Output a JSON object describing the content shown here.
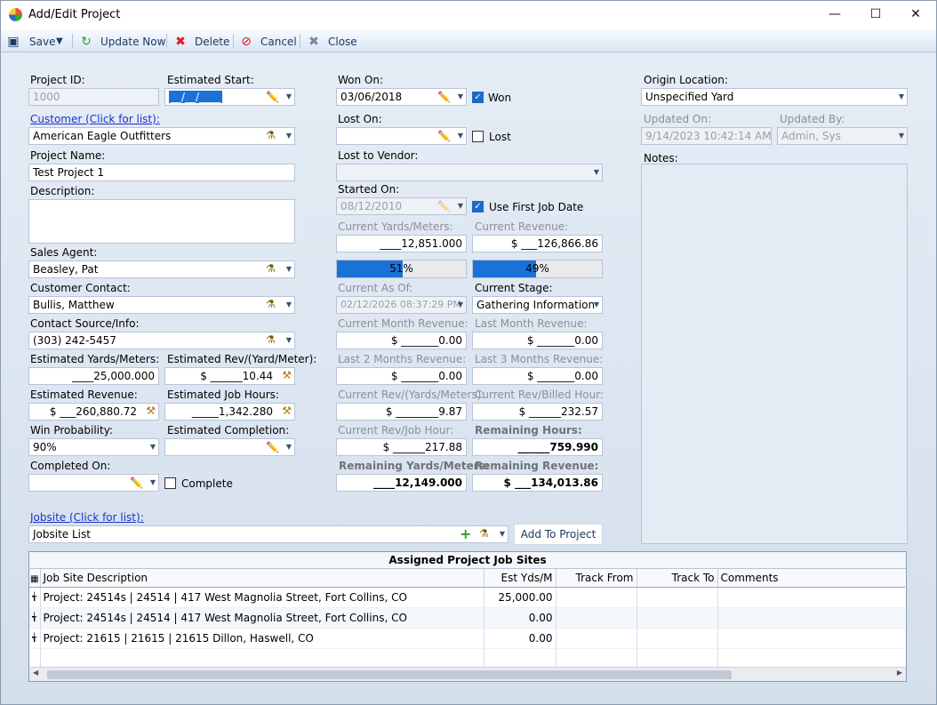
{
  "window": {
    "title": "Add/Edit Project"
  },
  "toolbar": {
    "save": "Save",
    "update_now": "Update Now",
    "delete": "Delete",
    "cancel": "Cancel",
    "close": "Close"
  },
  "left": {
    "project_id_label": "Project ID:",
    "project_id": "1000",
    "est_start_label": "Estimated Start:",
    "est_start": "__/__/____",
    "customer_label": "Customer (Click for list):",
    "customer": "American Eagle Outfitters",
    "project_name_label": "Project Name:",
    "project_name": "Test Project 1",
    "description_label": "Description:",
    "sales_agent_label": "Sales Agent:",
    "sales_agent": "Beasley, Pat",
    "customer_contact_label": "Customer Contact:",
    "customer_contact": "Bullis, Matthew",
    "contact_source_label": "Contact Source/Info:",
    "contact_source": "(303) 242-5457",
    "est_yards_label": "Estimated Yards/Meters:",
    "est_yards": "____25,000.000",
    "est_rev_yard_label": "Estimated Rev/(Yard/Meter):",
    "est_rev_yard": "$ ______10.44",
    "est_revenue_label": "Estimated Revenue:",
    "est_revenue": "$ ___260,880.72",
    "est_job_hours_label": "Estimated Job Hours:",
    "est_job_hours": "_____1,342.280",
    "win_prob_label": "Win Probability:",
    "win_prob": "90%",
    "est_completion_label": "Estimated Completion:",
    "completed_on_label": "Completed On:",
    "complete_label": "Complete",
    "jobsite_label": "Jobsite (Click for list):",
    "jobsite": "Jobsite List",
    "add_to_project": "Add To Project"
  },
  "middle": {
    "won_on_label": "Won On:",
    "won_on": "03/06/2018",
    "won_label": "Won",
    "lost_on_label": "Lost On:",
    "lost_label": "Lost",
    "lost_vendor_label": "Lost to Vendor:",
    "started_on_label": "Started On:",
    "started_on": "08/12/2010",
    "use_first_job_label": "Use First Job Date",
    "cur_yards_label": "Current Yards/Meters:",
    "cur_yards": "____12,851.000",
    "cur_revenue_label": "Current Revenue:",
    "cur_revenue": "$ ___126,866.86",
    "progress1_text": "51%",
    "progress1": 51,
    "progress2_text": "49%",
    "progress2": 49,
    "cur_as_of_label": "Current As Of:",
    "cur_as_of": "02/12/2026 08:37:29 PM",
    "cur_stage_label": "Current Stage:",
    "cur_stage": "Gathering Information",
    "cur_month_rev_label": "Current Month Revenue:",
    "cur_month_rev": "$ _______0.00",
    "last_month_rev_label": "Last Month Revenue:",
    "last_month_rev": "$ _______0.00",
    "last2_label": "Last 2 Months Revenue:",
    "last2": "$ _______0.00",
    "last3_label": "Last 3 Months Revenue:",
    "last3": "$ _______0.00",
    "cur_rev_yard_label": "Current Rev/(Yards/Meters):",
    "cur_rev_yard": "$ ________9.87",
    "cur_rev_billed_label": "Current Rev/Billed Hour:",
    "cur_rev_billed": "$ ______232.57",
    "cur_rev_job_label": "Current Rev/Job Hour:",
    "cur_rev_job": "$ ______217.88",
    "remaining_hours_label": "Remaining Hours:",
    "remaining_hours": "______759.990",
    "remaining_yards_label": "Remaining Yards/Meters:",
    "remaining_yards": "____12,149.000",
    "remaining_rev_label": "Remaining Revenue:",
    "remaining_rev": "$ ___134,013.86"
  },
  "right": {
    "origin_label": "Origin Location:",
    "origin": "Unspecified Yard",
    "updated_on_label": "Updated On:",
    "updated_on": "9/14/2023 10:42:14 AM",
    "updated_by_label": "Updated By:",
    "updated_by": "Admin, Sys",
    "notes_label": "Notes:"
  },
  "grid": {
    "caption": "Assigned Project Job Sites",
    "headers": [
      "Job Site Description",
      "Est Yds/M",
      "Track From",
      "Track To",
      "Comments"
    ],
    "rows": [
      {
        "desc": "Project: 24514s | 24514 | 417 West Magnolia Street, Fort Collins, CO",
        "yds": "25,000.00"
      },
      {
        "desc": "Project: 24514s | 24514 | 417 West Magnolia Street, Fort Collins, CO",
        "yds": "0.00"
      },
      {
        "desc": "Project: 21615 | 21615 | 21615 Dillon, Haswell, CO",
        "yds": "0.00"
      }
    ]
  }
}
